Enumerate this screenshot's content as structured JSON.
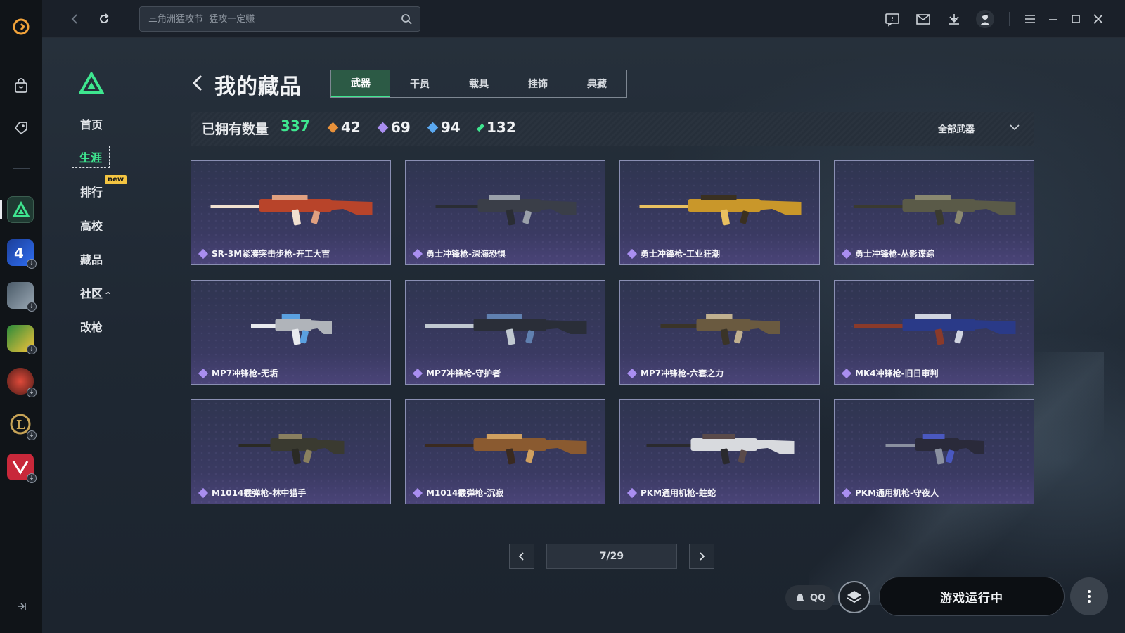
{
  "search": {
    "placeholder": "三角洲猛攻节  猛攻一定赚"
  },
  "subnav": {
    "items": [
      {
        "label": "首页"
      },
      {
        "label": "生涯"
      },
      {
        "label": "排行"
      },
      {
        "label": "高校"
      },
      {
        "label": "藏品"
      },
      {
        "label": "社区"
      },
      {
        "label": "改枪"
      }
    ],
    "new_badge": "new",
    "community_caret": "^"
  },
  "header": {
    "title": "我的藏品",
    "tabs": [
      {
        "label": "武器",
        "active": true
      },
      {
        "label": "干员",
        "active": false
      },
      {
        "label": "载具",
        "active": false
      },
      {
        "label": "挂饰",
        "active": false
      },
      {
        "label": "典藏",
        "active": false
      }
    ]
  },
  "stats": {
    "owned_label": "已拥有数量",
    "owned_count": "337",
    "rarities": [
      {
        "value": "42",
        "color": "#e8913a"
      },
      {
        "value": "69",
        "color": "#a98ef0"
      },
      {
        "value": "94",
        "color": "#5aa8f0"
      },
      {
        "value": "132",
        "color": "#3ee68f"
      }
    ],
    "filter_label": "全部武器"
  },
  "items": [
    {
      "name": "SR-3M紧凑突击步枪-开工大吉",
      "rarity_color": "#a98ef0"
    },
    {
      "name": "勇士冲锋枪-深海恐惧",
      "rarity_color": "#a98ef0"
    },
    {
      "name": "勇士冲锋枪-工业狂潮",
      "rarity_color": "#a98ef0"
    },
    {
      "name": "勇士冲锋枪-丛影谍踪",
      "rarity_color": "#a98ef0"
    },
    {
      "name": "MP7冲锋枪-无垢",
      "rarity_color": "#a98ef0"
    },
    {
      "name": "MP7冲锋枪-守护者",
      "rarity_color": "#a98ef0"
    },
    {
      "name": "MP7冲锋枪-六套之力",
      "rarity_color": "#a98ef0"
    },
    {
      "name": "MK4冲锋枪-旧日审判",
      "rarity_color": "#a98ef0"
    },
    {
      "name": "M1014霰弹枪-林中猎手",
      "rarity_color": "#a98ef0"
    },
    {
      "name": "M1014霰弹枪-沉寂",
      "rarity_color": "#a98ef0"
    },
    {
      "name": "PKM通用机枪-蛀蛇",
      "rarity_color": "#a98ef0"
    },
    {
      "name": "PKM通用机枪-守夜人",
      "rarity_color": "#a98ef0"
    }
  ],
  "pagination": {
    "current": "7/29"
  },
  "bottom": {
    "qq_label": "QQ",
    "run_label": "游戏运行中"
  },
  "colors": {
    "accent": "#3ee68f",
    "tab_active_bg": "#2c5a45",
    "card_border": "#8a8fb3"
  }
}
